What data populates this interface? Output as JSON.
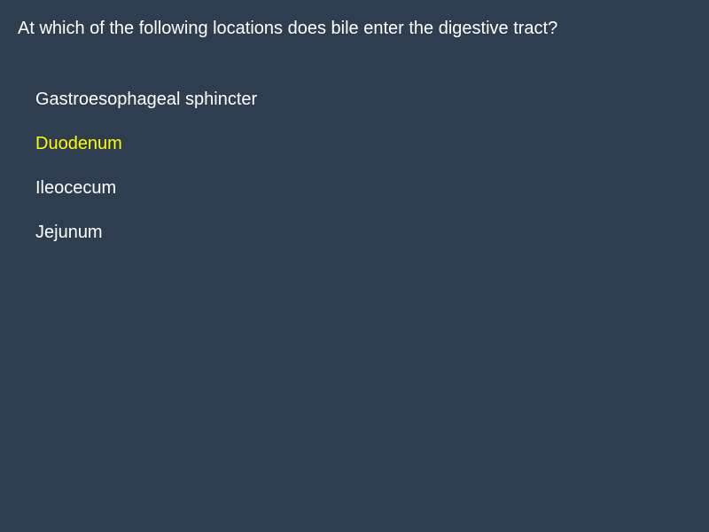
{
  "question": {
    "text": "At which of the following locations does bile enter the digestive tract?"
  },
  "options": [
    {
      "label": "Gastroesophageal sphincter",
      "selected": false
    },
    {
      "label": "Duodenum",
      "selected": true
    },
    {
      "label": "Ileocecum",
      "selected": false
    },
    {
      "label": "Jejunum",
      "selected": false
    }
  ],
  "colors": {
    "background": "#2e3d50",
    "text": "#ffffff",
    "selected": "#ffff00"
  }
}
